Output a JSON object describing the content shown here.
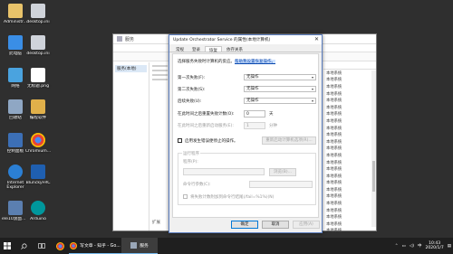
{
  "desktop": {
    "icons": [
      {
        "label": "Administr...",
        "icon": "user-folder-icon"
      },
      {
        "label": "desktop.ini",
        "icon": "ini-file-icon"
      },
      {
        "label": "此电脑",
        "icon": "computer-icon"
      },
      {
        "label": "desktop.ini",
        "icon": "ini-file-icon"
      },
      {
        "label": "网络",
        "icon": "network-icon"
      },
      {
        "label": "无标题.png",
        "icon": "image-file-icon"
      },
      {
        "label": "回收站",
        "icon": "recycle-bin-icon"
      },
      {
        "label": "编程软件",
        "icon": "folder-icon"
      },
      {
        "label": "控制面板",
        "icon": "control-panel-icon"
      },
      {
        "label": "Chromium...",
        "icon": "chromium-icon"
      },
      {
        "label": "Internet Explorer",
        "icon": "ie-icon"
      },
      {
        "label": "BlunckyFRC",
        "icon": "frc-icon"
      },
      {
        "label": "ele10渡面主题...",
        "icon": "app-icon"
      },
      {
        "label": "Arduino",
        "icon": "arduino-icon"
      }
    ]
  },
  "services_window": {
    "title": "服务",
    "tree_node": "服务(本地)",
    "bottom_tab": "扩展",
    "right_rows": [
      "本地系统",
      "本地系统",
      "本地系统",
      "本地系统",
      "本地系统",
      "本地系统",
      "本地系统",
      "本地系统",
      "本地系统",
      "本地系统",
      "本地系统",
      "本地系统",
      "本地系统",
      "本地系统",
      "本地系统",
      "本地系统",
      "本地系统",
      "本地系统",
      "本地系统",
      "本地系统",
      "本地系统",
      "本地系统",
      "本地系统",
      "本地系统"
    ]
  },
  "dialog": {
    "title": "Update Orchestrator Service 的属性(本地计算机)",
    "tabs": [
      "常规",
      "登录",
      "恢复",
      "依存关系"
    ],
    "active_tab": "恢复",
    "intro_text": "选择服务失败时计算机的反应。",
    "intro_link": "帮助我设置恢复操作。",
    "first_failure_label": "第一次失败(F):",
    "first_failure_value": "无操作",
    "second_failure_label": "第二次失败(S):",
    "second_failure_value": "无操作",
    "subsequent_failure_label": "后续失败(U):",
    "subsequent_failure_value": "无操作",
    "reset_count_label": "在此时间之后重置失败计数(O):",
    "reset_count_value": "0",
    "reset_count_unit": "天",
    "restart_after_label": "在此时间之后重新启动服务(E):",
    "restart_after_value": "1",
    "restart_after_unit": "分钟",
    "enable_actions_label": "启用发生错误便停止的操作。",
    "restart_options_button": "重新启动计算机选项(R)...",
    "run_program_group": "运行程序",
    "program_label": "程序(P):",
    "browse_button": "浏览(B)...",
    "params_label": "命令行参数(C):",
    "append_fail_label": "将失败计数附加到命令行结尾(/fail=%1%)(N)",
    "ok_button": "确定",
    "cancel_button": "取消",
    "apply_button": "应用(A)"
  },
  "taskbar": {
    "apps": [
      {
        "label": "",
        "icon": "start-icon"
      },
      {
        "label": "",
        "icon": "search-icon"
      },
      {
        "label": "",
        "icon": "task-view-icon"
      },
      {
        "label": "",
        "icon": "chrome-taskbar-icon"
      },
      {
        "label": "写文章 - 知乎 - Go...",
        "icon": "chrome-window-icon"
      },
      {
        "label": "服务",
        "icon": "services-icon"
      }
    ],
    "time": "10:43",
    "date": "2020/1/7",
    "ime": "中"
  }
}
